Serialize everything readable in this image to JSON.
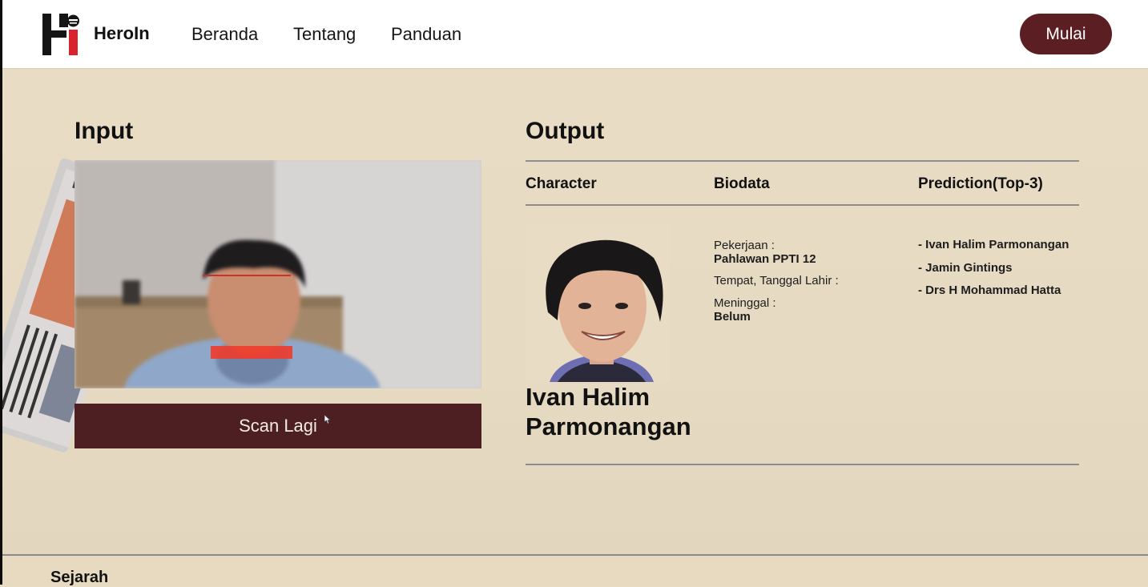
{
  "nav": {
    "brand": "HeroIn",
    "links": [
      "Beranda",
      "Tentang",
      "Panduan"
    ],
    "cta": "Mulai"
  },
  "input": {
    "title": "Input",
    "scan_button": "Scan Lagi"
  },
  "output": {
    "title": "Output",
    "columns": [
      "Character",
      "Biodata",
      "Prediction(Top-3)"
    ],
    "character_name": "Ivan Halim Parmonangan",
    "biodata": {
      "pekerjaan_label": "Pekerjaan :",
      "pekerjaan_value": "Pahlawan PPTI 12",
      "ttl_label": "Tempat, Tanggal Lahir :",
      "meninggal_label": "Meninggal :",
      "meninggal_value": "Belum"
    },
    "predictions": [
      "- Ivan Halim Parmonangan",
      "- Jamin Gintings",
      "- Drs H Mohammad Hatta"
    ]
  },
  "footer": {
    "title": "Sejarah"
  },
  "colors": {
    "accent": "#5b1e22",
    "background": "#e8dcc4",
    "button_dark": "#4d1f22"
  }
}
